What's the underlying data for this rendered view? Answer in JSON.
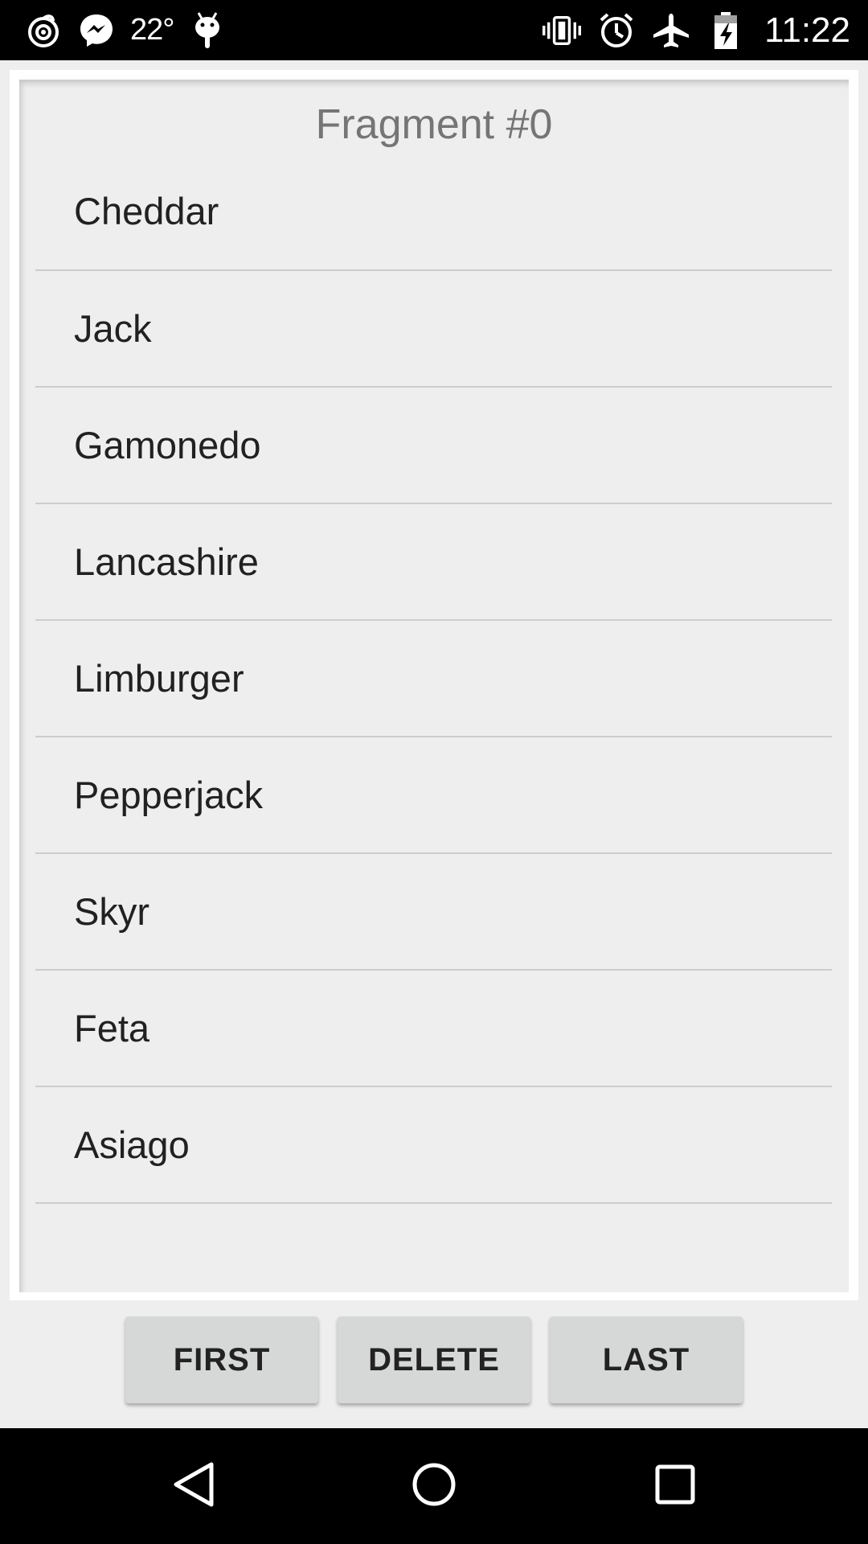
{
  "status_bar": {
    "icons_left": [
      "hotspot-icon",
      "messenger-icon",
      "android-icon"
    ],
    "temperature": "22°",
    "icons_right": [
      "vibrate-icon",
      "alarm-icon",
      "airplane-mode-icon",
      "battery-charging-icon"
    ],
    "time": "11:22"
  },
  "fragment": {
    "title": "Fragment #0",
    "items": [
      "Cheddar",
      "Jack",
      "Gamonedo",
      "Lancashire",
      "Limburger",
      "Pepperjack",
      "Skyr",
      "Feta",
      "Asiago"
    ]
  },
  "buttons": {
    "first": "FIRST",
    "delete": "DELETE",
    "last": "LAST"
  },
  "nav_bar": {
    "icons": [
      "back-icon",
      "home-icon",
      "recents-icon"
    ]
  },
  "colors": {
    "background": "#eeeeee",
    "status_bar": "#000000",
    "button": "#d6d7d7",
    "title_text": "#757575",
    "item_text": "#212121",
    "divider": "#cccccc"
  }
}
